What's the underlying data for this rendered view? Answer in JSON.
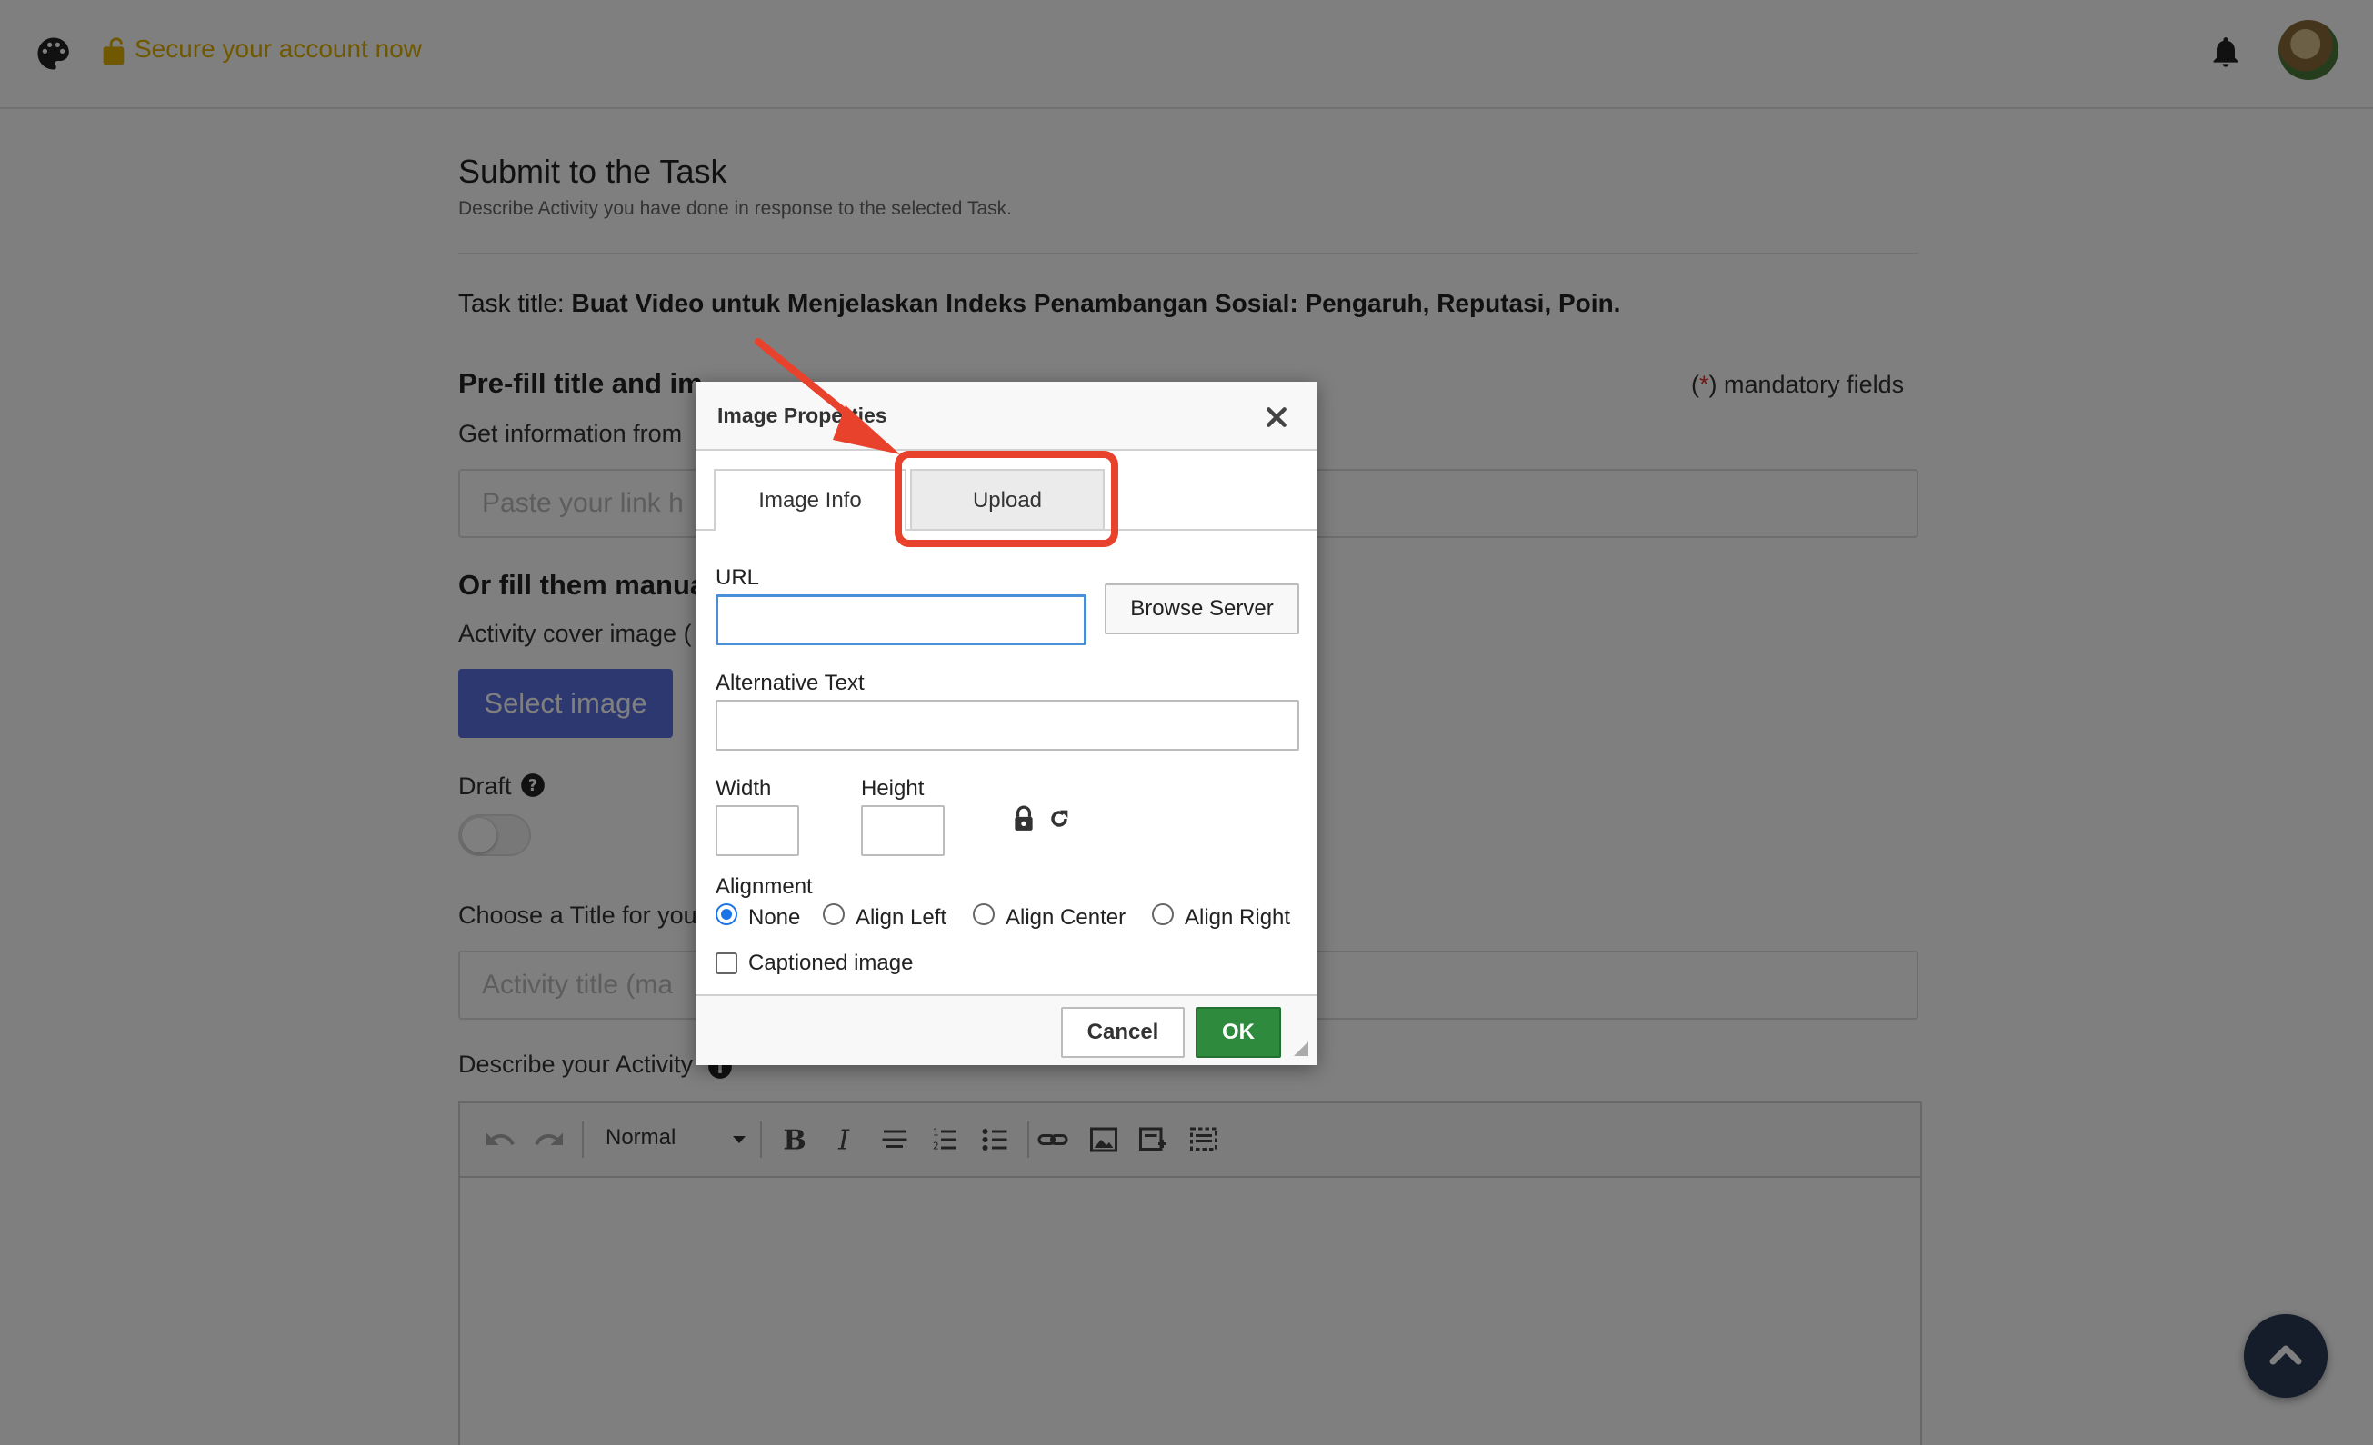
{
  "topbar": {
    "secure_link": "Secure your account now",
    "icons": [
      "palette-icon",
      "lock-open-icon",
      "bell-icon",
      "avatar"
    ]
  },
  "page": {
    "title": "Submit to the Task",
    "subtitle": "Describe Activity you have done in response to the selected Task.",
    "task_label": "Task title:",
    "task_title": "Buat Video untuk Menjelaskan Indeks Penambangan Sosial: Pengaruh, Reputasi, Poin.",
    "section_prefill": "Pre-fill title and im",
    "mandatory_open": "(",
    "mandatory_star": "*",
    "mandatory_rest": ") mandatory fields",
    "get_info": "Get information from",
    "link_placeholder": "Paste your link h",
    "section_manual": "Or fill them manua",
    "cover_label": "Activity cover image (",
    "select_image": "Select image",
    "draft_label": "Draft",
    "title_label": "Choose a Title for you",
    "title_placeholder": "Activity title (ma",
    "describe_label": "Describe your Activity"
  },
  "editor": {
    "format_value": "Normal",
    "tools": [
      "undo-icon",
      "redo-icon",
      "bold-icon",
      "italic-icon",
      "strikethrough-icon",
      "numbered-list-icon",
      "bulleted-list-icon",
      "link-icon",
      "image-icon",
      "insert-block-icon",
      "select-all-icon"
    ]
  },
  "dialog": {
    "title": "Image Properties",
    "tabs": [
      {
        "label": "Image Info",
        "active": true
      },
      {
        "label": "Upload",
        "active": false
      }
    ],
    "url_label": "URL",
    "url_value": "",
    "browse_server": "Browse Server",
    "alt_label": "Alternative Text",
    "alt_value": "",
    "width_label": "Width",
    "height_label": "Height",
    "alignment_label": "Alignment",
    "alignment_options": [
      "None",
      "Align Left",
      "Align Center",
      "Align Right"
    ],
    "alignment_selected": "None",
    "captioned_label": "Captioned image",
    "captioned_checked": false,
    "cancel": "Cancel",
    "ok": "OK"
  },
  "colors": {
    "overlay": "#000000",
    "accent_blue": "#5b6ee1",
    "ok_green": "#2e8b3e",
    "annotation_red": "#e8412c",
    "secure_yellow": "#e0b000",
    "scroll_button": "#2b3a55"
  }
}
